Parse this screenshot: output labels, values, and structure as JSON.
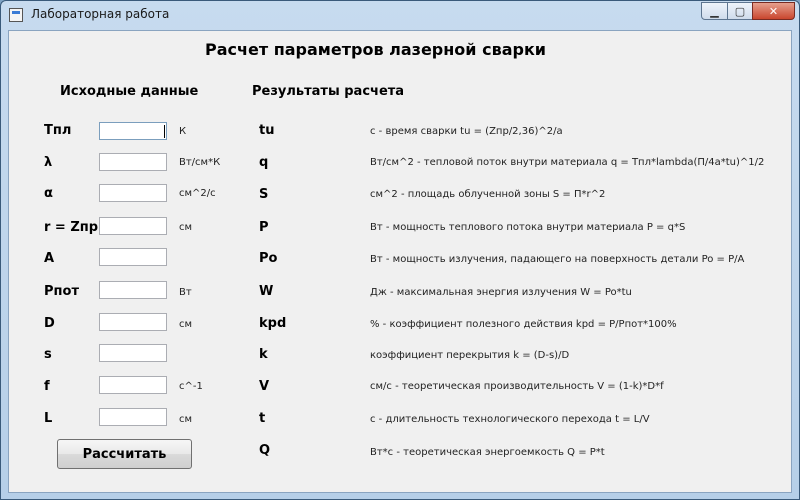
{
  "window": {
    "title": "Лабораторная работа"
  },
  "main": {
    "title": "Расчет параметров лазерной сварки",
    "inputs_heading": "Исходные данные",
    "results_heading": "Результаты расчета",
    "inputs": [
      {
        "label": "Тпл",
        "unit": "К",
        "value": ""
      },
      {
        "label": "λ",
        "unit": "Вт/см*К",
        "value": ""
      },
      {
        "label": "α",
        "unit": "см^2/с",
        "value": ""
      },
      {
        "label": "r = Zпр",
        "unit": "см",
        "value": ""
      },
      {
        "label": "A",
        "unit": "",
        "value": ""
      },
      {
        "label": "Pпот",
        "unit": "Вт",
        "value": ""
      },
      {
        "label": "D",
        "unit": "см",
        "value": ""
      },
      {
        "label": "s",
        "unit": "",
        "value": ""
      },
      {
        "label": "f",
        "unit": "с^-1",
        "value": ""
      },
      {
        "label": "L",
        "unit": "см",
        "value": ""
      }
    ],
    "results": [
      {
        "label": "tu",
        "desc": "с - время сварки tu = (Zпр/2,36)^2/а"
      },
      {
        "label": "q",
        "desc": "Вт/см^2 - тепловой поток внутри материала q = Тпл*lambda(П/4а*tu)^1/2"
      },
      {
        "label": "S",
        "desc": "см^2 - площадь облученной зоны S = П*r^2"
      },
      {
        "label": "P",
        "desc": "Вт - мощность теплового потока внутри материала P = q*S"
      },
      {
        "label": "Po",
        "desc": "Вт - мощность излучения, падающего на поверхность детали Po = P/A"
      },
      {
        "label": "W",
        "desc": "Дж - максимальная энергия излучения W = Po*tu"
      },
      {
        "label": "kpd",
        "desc": "% - коэффициент полезного действия kpd = P/Pпот*100%"
      },
      {
        "label": "k",
        "desc": "коэффициент перекрытия k = (D-s)/D"
      },
      {
        "label": "V",
        "desc": "см/с - теоретическая производительность V = (1-k)*D*f"
      },
      {
        "label": "t",
        "desc": "с - длительность технологического перехода t = L/V"
      },
      {
        "label": "Q",
        "desc": "Вт*с - теоретическая энергоемкость Q = P*t"
      }
    ],
    "calculate_label": "Рассчитать"
  },
  "colors": {
    "client_bg": "#f0f0f0",
    "titlebar": "#c7dbef",
    "close_button": "#c9462e"
  },
  "icons": [
    "app-icon",
    "minimize-icon",
    "maximize-icon",
    "close-icon"
  ]
}
